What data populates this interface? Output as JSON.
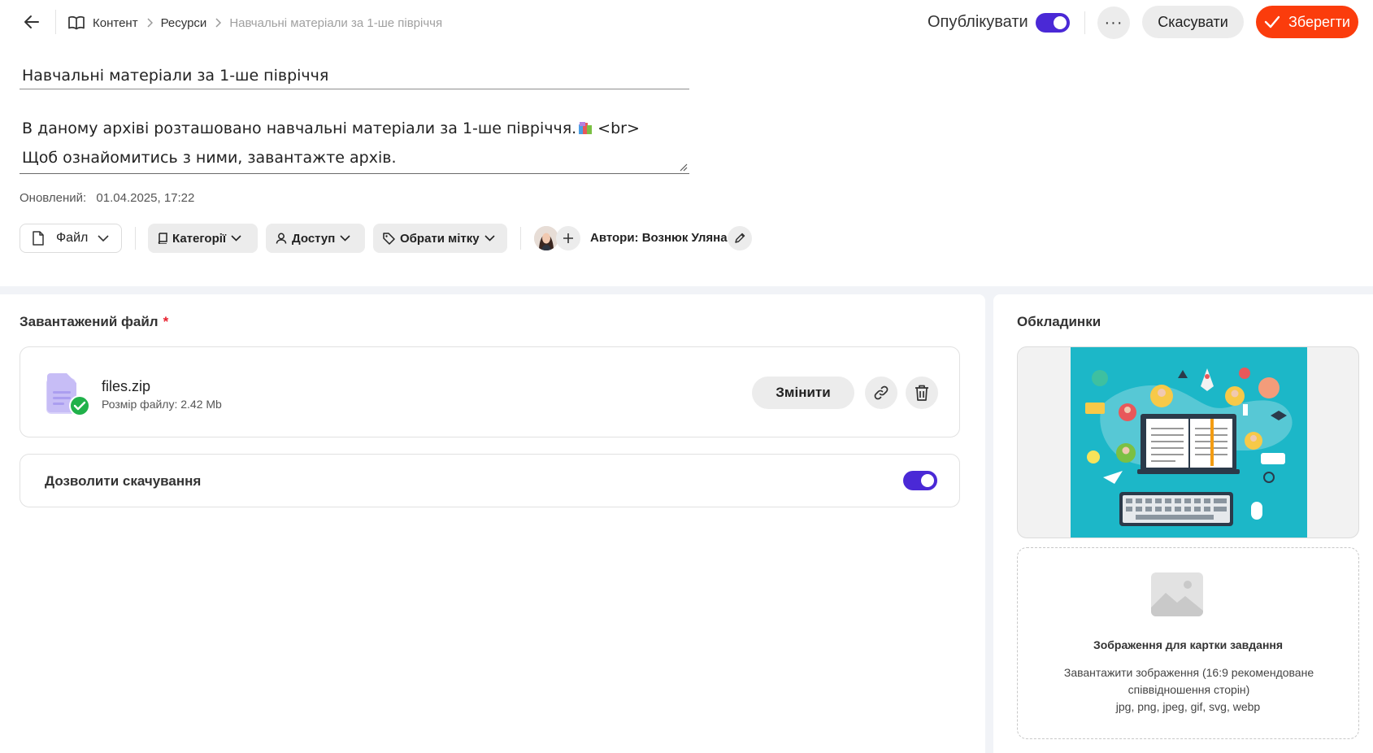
{
  "breadcrumbs": {
    "items": [
      "Контент",
      "Ресурси"
    ],
    "current": "Навчальні матеріали за 1-ше півріччя"
  },
  "header": {
    "publish_label": "Опублікувати",
    "publish_on": true,
    "more_label": "···",
    "cancel_label": "Скасувати",
    "save_label": "Зберегти"
  },
  "editor": {
    "title": "Навчальні матеріали за 1-ше півріччя",
    "description_line1": "В даному архіві розташовано навчальні матеріали за 1-ше півріччя.",
    "description_br": "<br>",
    "description_line2": "Щоб ознайомитись з ними, завантажте архів.",
    "updated_label": "Оновлений:",
    "updated_value": "01.04.2025, 17:22"
  },
  "toolbar": {
    "file_label": "Файл",
    "categories_label": "Категорії",
    "access_label": "Доступ",
    "tag_label": "Обрати мітку",
    "authors_label": "Автори: Вознюк Уляна"
  },
  "upload_section": {
    "title": "Завантажений файл",
    "required_mark": "*",
    "file_name": "files.zip",
    "file_size": "Розмір файлу: 2.42 Mb",
    "change_label": "Змінити",
    "allow_download_label": "Дозволити скачування",
    "allow_download_on": true
  },
  "covers": {
    "title": "Обкладинки",
    "upload_title": "Зображення для картки завдання",
    "upload_text": "Завантажити зображення (16:9 рекомендоване співвідношення сторін)",
    "upload_formats": "jpg, png, jpeg, gif, svg, webp"
  },
  "colors": {
    "accent": "#4a29d6",
    "save": "#fb3c0c",
    "success": "#20b14a",
    "cover_bg": "#1cb7c8"
  }
}
